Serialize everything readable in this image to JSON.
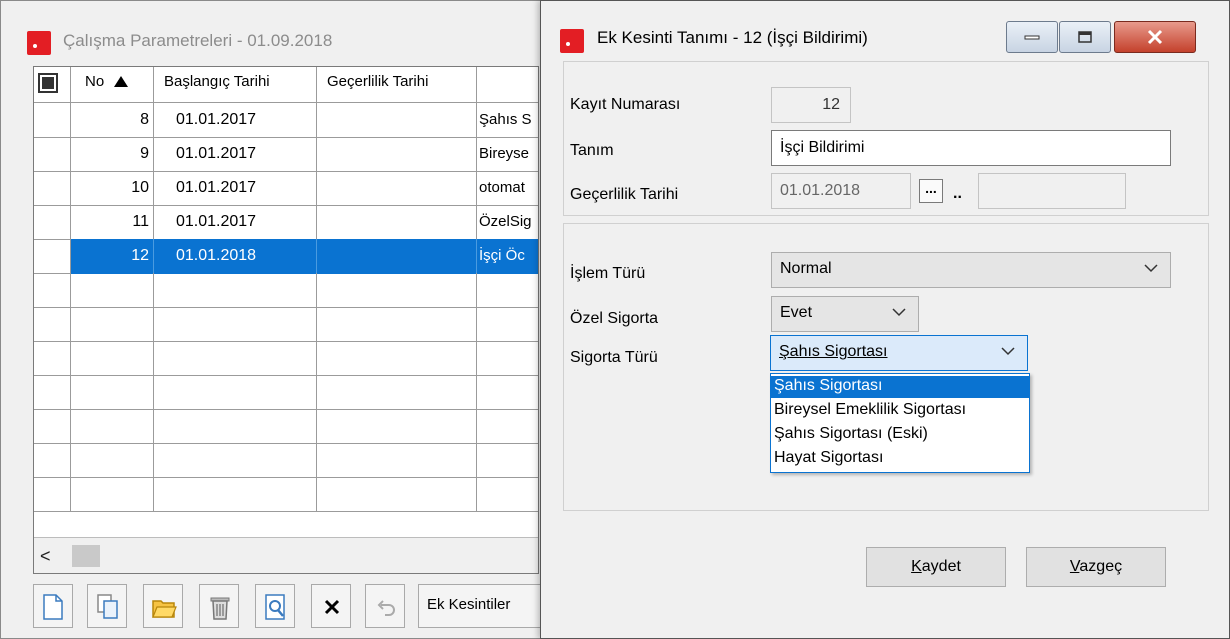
{
  "back_window": {
    "title": "Çalışma Parametreleri - 01.09.2018",
    "columns": [
      "No",
      "Başlangıç Tarihi",
      "Geçerlilik Tarihi"
    ],
    "rows": [
      {
        "no": "8",
        "start": "01.01.2017",
        "valid": "",
        "desc": "Şahıs S"
      },
      {
        "no": "9",
        "start": "01.01.2017",
        "valid": "",
        "desc": "Bireyse"
      },
      {
        "no": "10",
        "start": "01.01.2017",
        "valid": "",
        "desc": "otomat"
      },
      {
        "no": "11",
        "start": "01.01.2017",
        "valid": "",
        "desc": "ÖzelSig"
      },
      {
        "no": "12",
        "start": "01.01.2018",
        "valid": "",
        "desc": "İşçi Öc"
      }
    ],
    "selected_row": 4,
    "toolbar": {
      "new_icon": "new-document-icon",
      "copy_icon": "copy-icon",
      "open_icon": "open-folder-icon",
      "delete_icon": "trash-icon",
      "preview_icon": "preview-icon",
      "clear_icon": "close-icon",
      "undo_icon": "undo-icon",
      "ek_kesintiler_label": "Ek Kesintiler"
    }
  },
  "front_window": {
    "title": "Ek Kesinti Tanımı - 12 (İşçi Bildirimi)",
    "labels": {
      "kayit_numarasi": "Kayıt Numarası",
      "tanim": "Tanım",
      "gecerlilik_tarihi": "Geçerlilik Tarihi",
      "islem_turu": "İşlem Türü",
      "ozel_sigorta": "Özel Sigorta",
      "sigorta_turu": "Sigorta Türü"
    },
    "values": {
      "kayit_numarasi": "12",
      "tanim": "İşçi Bildirimi",
      "gecerlilik_tarihi": "01.01.2018",
      "gecerlilik_bitis": "",
      "dots": "...",
      "range_sep": "..",
      "islem_turu": "Normal",
      "ozel_sigorta": "Evet",
      "sigorta_turu": "Şahıs Sigortası"
    },
    "sigorta_turu_options": [
      "Şahıs Sigortası",
      "Bireysel Emeklilik Sigortası",
      "Şahıs Sigortası (Eski)",
      "Hayat Sigortası"
    ],
    "buttons": {
      "save_mnemonic": "K",
      "save_rest": "aydet",
      "cancel_mnemonic": "V",
      "cancel_rest": "azgeç"
    },
    "colors": {
      "selection": "#0a73d1",
      "close_button": "#c4412c"
    }
  }
}
